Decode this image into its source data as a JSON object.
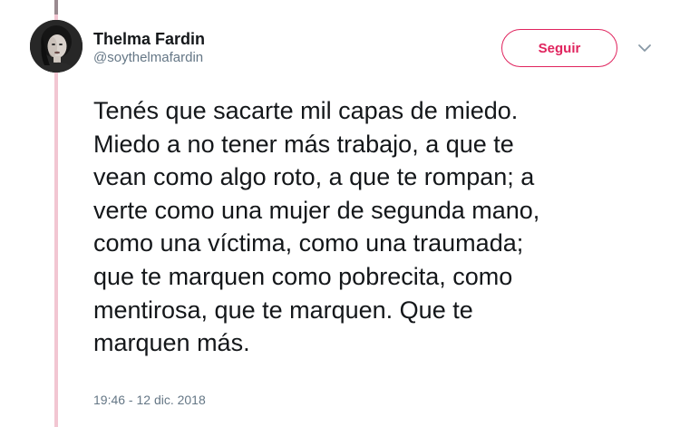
{
  "author": {
    "display_name": "Thelma Fardin",
    "handle": "@soythelmafardin"
  },
  "follow_button": {
    "label": "Seguir"
  },
  "tweet": {
    "lines": [
      "Tenés que sacarte mil capas de miedo.",
      "Miedo a no tener más trabajo, a que te",
      "vean como algo roto, a que te rompan; a",
      "verte como una mujer de segunda mano,",
      "como una víctima, como una traumada;",
      "que te marquen como pobrecita, como",
      "mentirosa, que te marquen. Que te",
      "marquen más."
    ],
    "timestamp": "19:46 - 12 dic. 2018"
  },
  "colors": {
    "accent": "#e0245e",
    "thread_line": "#f2c6d2",
    "secondary_text": "#657786",
    "primary_text": "#14171a"
  },
  "icons": {
    "menu": "chevron-down-icon",
    "avatar": "profile-photo"
  }
}
